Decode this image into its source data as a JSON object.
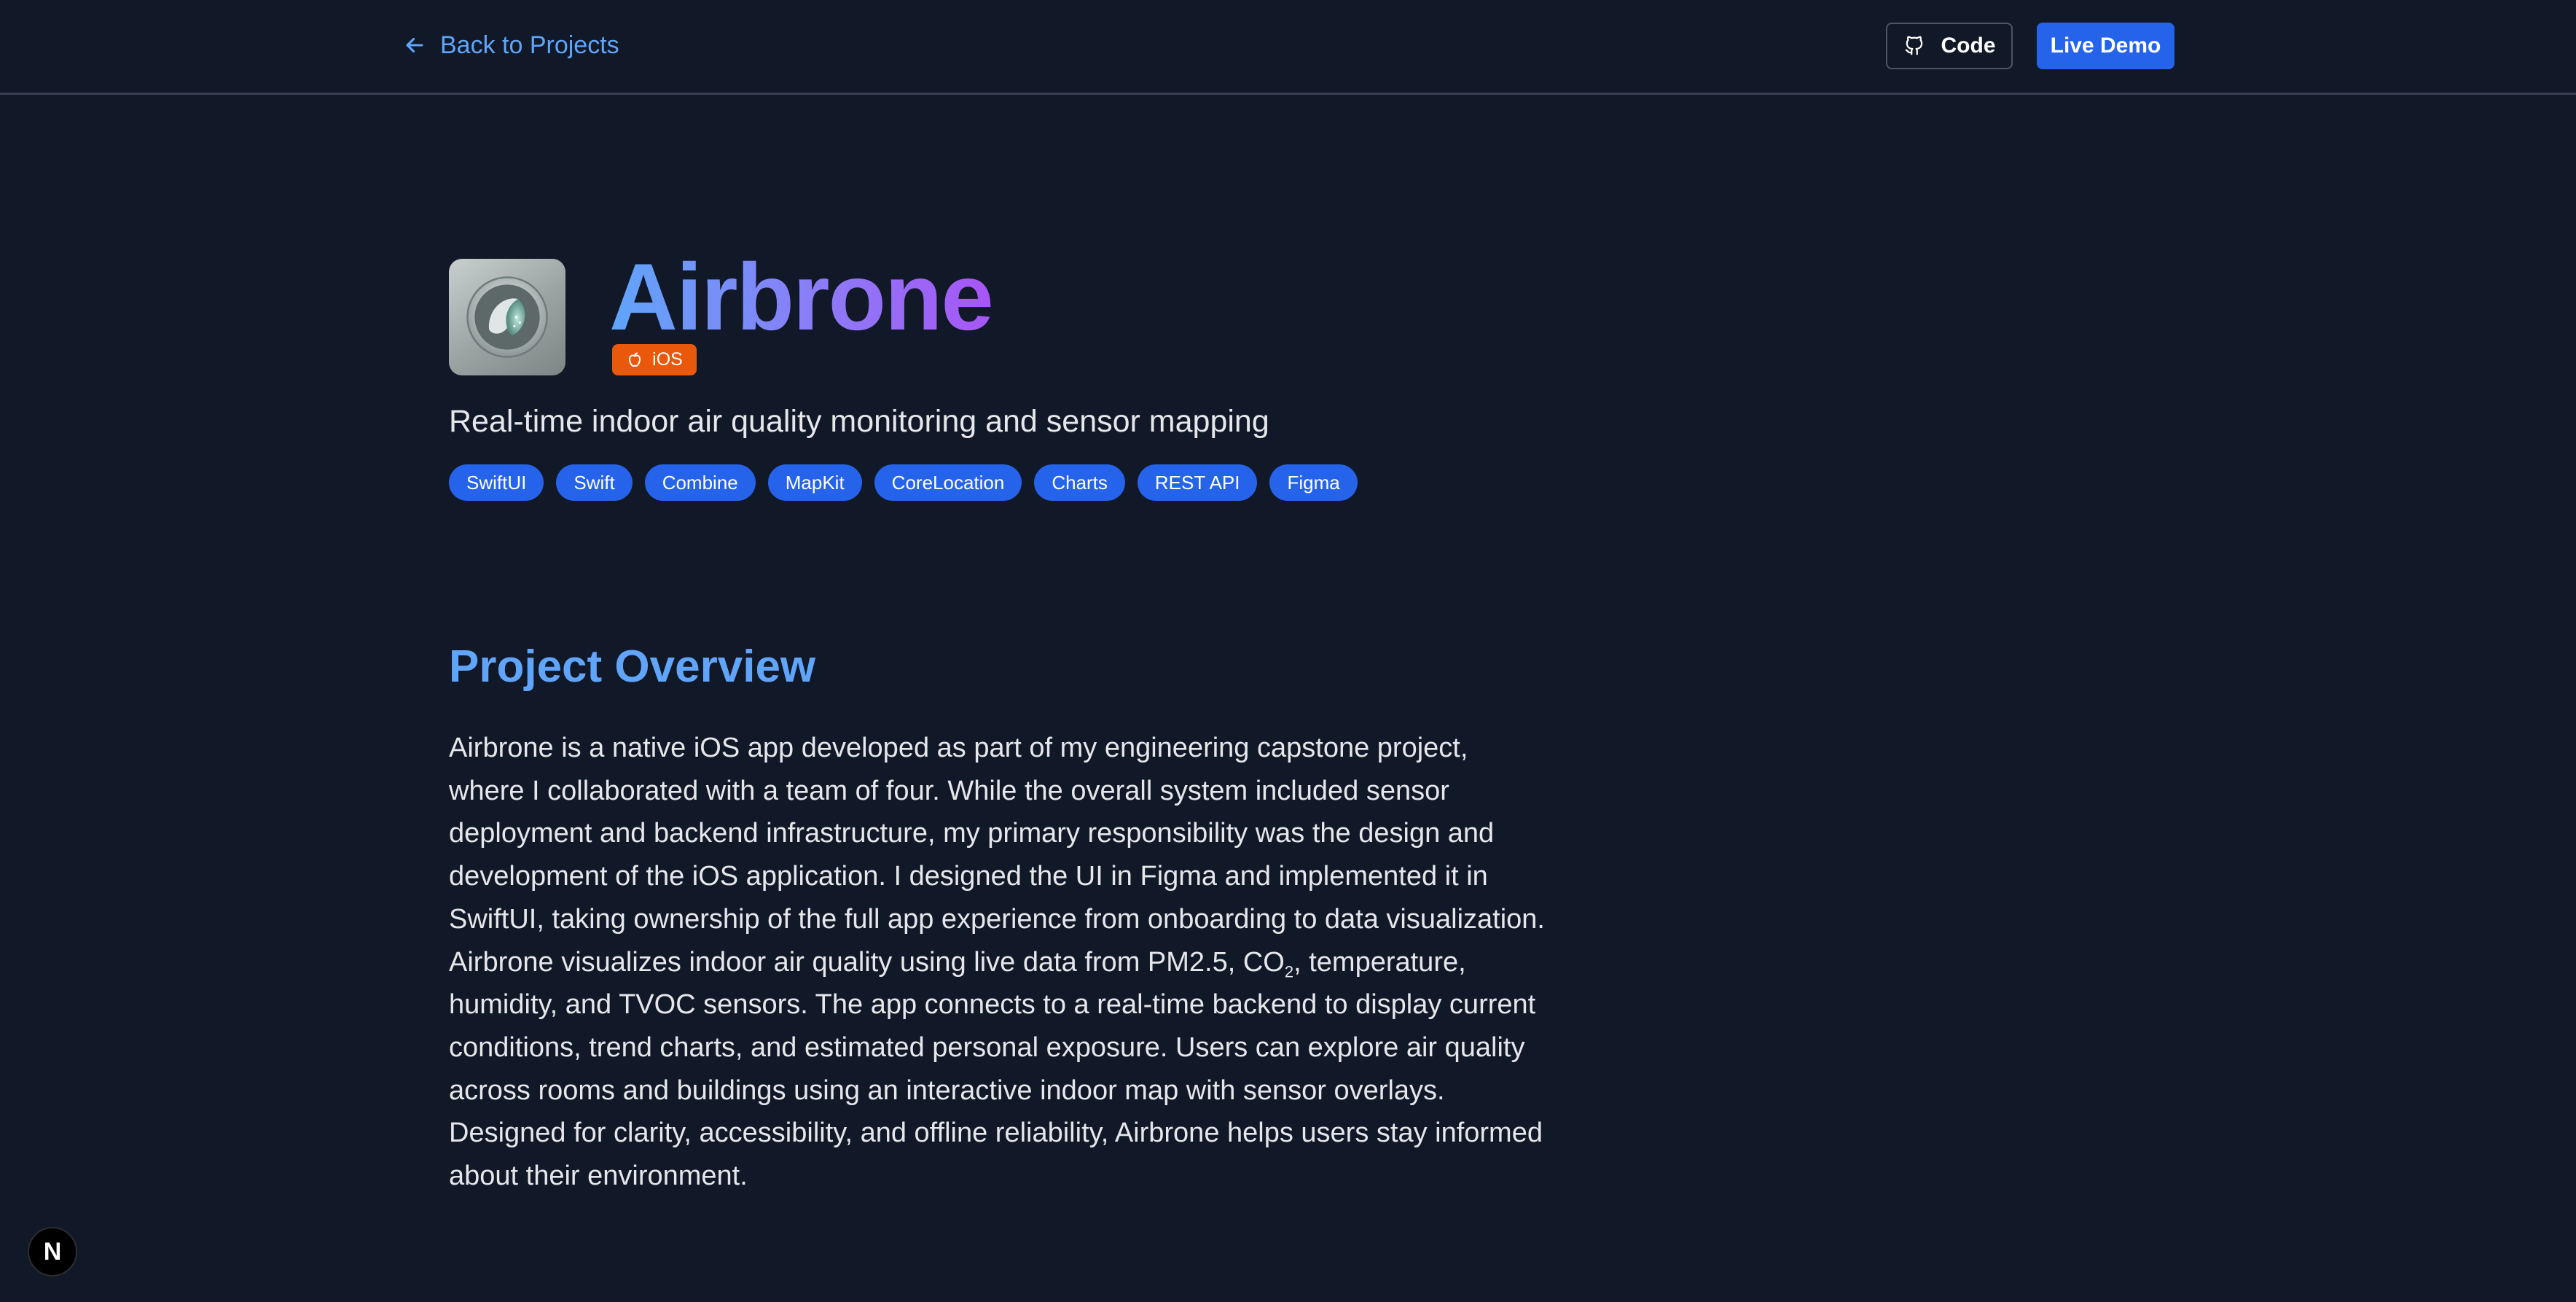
{
  "nav": {
    "back_label": "Back to Projects",
    "code_label": "Code",
    "demo_label": "Live Demo"
  },
  "project": {
    "title": "Airbrone",
    "platform": "iOS",
    "subtitle": "Real-time indoor air quality monitoring and sensor mapping",
    "tags": [
      "SwiftUI",
      "Swift",
      "Combine",
      "MapKit",
      "CoreLocation",
      "Charts",
      "REST API",
      "Figma"
    ]
  },
  "overview": {
    "heading": "Project Overview",
    "text_before": "Airbrone is a native iOS app developed as part of my engineering capstone project, where I collaborated with a team of four. While the overall system included sensor deployment and backend infrastructure, my primary responsibility was the design and development of the iOS application. I designed the UI in Figma and implemented it in SwiftUI, taking ownership of the full app experience from onboarding to data visualization. Airbrone visualizes indoor air quality using live data from PM2.5, CO",
    "subscript": "2",
    "text_after": ", temperature, humidity, and TVOC sensors. The app connects to a real-time backend to display current conditions, trend charts, and estimated personal exposure. Users can explore air quality across rooms and buildings using an interactive indoor map with sensor overlays. Designed for clarity, accessibility, and offline reliability, Airbrone helps users stay informed about their environment."
  },
  "dev_indicator": {
    "letter": "N"
  },
  "colors": {
    "background": "#111827",
    "accent": "#2563eb",
    "link": "#60a5fa",
    "platform_badge": "#ea580c",
    "title_gradient": [
      "#60a5fa",
      "#a855f7"
    ]
  },
  "icons": [
    "arrow-left-icon",
    "github-icon",
    "apple-icon",
    "app-icon",
    "next-logo-icon"
  ]
}
